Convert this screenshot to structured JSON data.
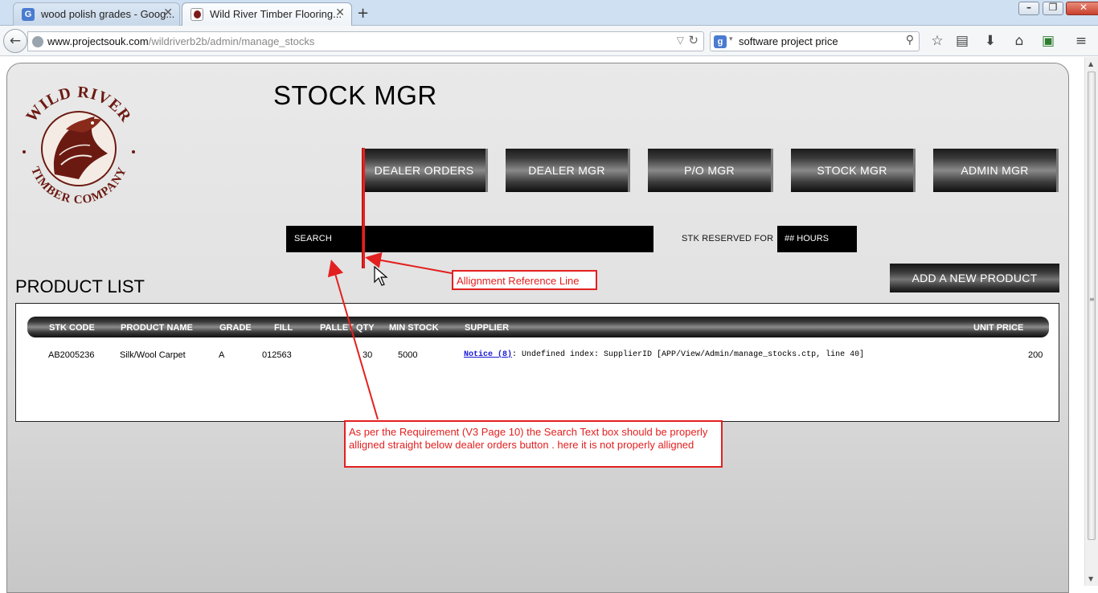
{
  "browser": {
    "tabs": [
      {
        "title": "wood polish grades - Goog...",
        "close": "✕",
        "favicon": "G"
      },
      {
        "title": "Wild River Timber Flooring...",
        "close": "✕"
      }
    ],
    "new_tab": "+",
    "window_controls": {
      "minimize": "–",
      "restore": "❐",
      "close": "✕"
    },
    "url_domain": "www.projectsouk.com",
    "url_path": "/wildriverb2b/admin/manage_stocks",
    "search_engine": "g",
    "search_query": "software project price",
    "toolbar_icons": [
      "star-icon",
      "reading-list-icon",
      "download-icon",
      "home-icon",
      "extension-icon",
      "menu-icon"
    ]
  },
  "page": {
    "title": "STOCK MGR",
    "nav": [
      "DEALER ORDERS",
      "DEALER MGR",
      "P/O MGR",
      "STOCK MGR",
      "ADMIN MGR"
    ],
    "search_label": "SEARCH",
    "stk_reserved_label": "STK RESERVED FOR",
    "hours_label": "## HOURS",
    "add_product": "ADD A NEW PRODUCT",
    "list_title": "PRODUCT LIST",
    "columns": [
      "STK CODE",
      "PRODUCT NAME",
      "GRADE",
      "FILL",
      "PALLET QTY",
      "MIN STOCK",
      "SUPPLIER",
      "UNIT PRICE"
    ],
    "rows": [
      {
        "stk_code": "AB2005236",
        "product_name": "Silk/Wool Carpet",
        "grade": "A",
        "fill": "012563",
        "pallet_qty": "30",
        "min_stock": "5000",
        "supplier_notice_link": "Notice (8)",
        "supplier_notice_text": ": Undefined index:  SupplierID [APP/View/Admin/manage_stocks.ctp, line 40]",
        "unit_price": "200"
      }
    ],
    "logo": {
      "line1": "WILD RIVER",
      "line2": "TIMBER COMPANY"
    }
  },
  "annotations": {
    "callout1": "Allignment Reference Line",
    "callout2": "As per the Requirement (V3 Page 10) the Search Text box should be properly alligned straight below dealer orders button . here it is not properly alligned",
    "color": "#e32020"
  },
  "colors": {
    "accent": "#e32020",
    "logo_brown": "#6b1a12",
    "button_dark": "#1b1b1b"
  }
}
